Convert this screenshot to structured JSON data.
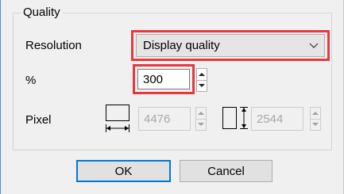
{
  "group": {
    "title": "Quality"
  },
  "resolution": {
    "label": "Resolution",
    "selected": "Display quality"
  },
  "percent": {
    "label": "%",
    "value": "300"
  },
  "pixel": {
    "label": "Pixel",
    "width_value": "4476",
    "height_value": "2544"
  },
  "buttons": {
    "ok": "OK",
    "cancel": "Cancel"
  },
  "colors": {
    "highlight": "#e8383d",
    "focus": "#0078d7",
    "disabled_text": "#a8a8a8"
  },
  "icons": {
    "dropdown": "chevron-down-icon",
    "spin_up": "triangle-up-icon",
    "spin_down": "triangle-down-icon",
    "width": "width-dimension-icon",
    "height": "height-dimension-icon"
  }
}
